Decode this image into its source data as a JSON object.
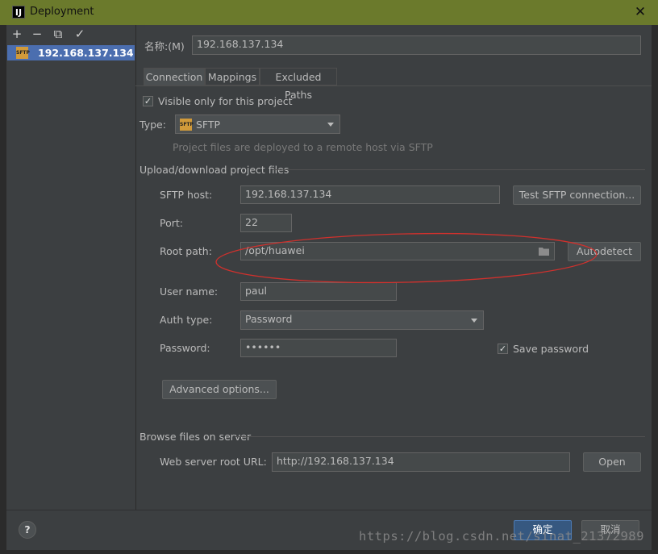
{
  "window": {
    "title": "Deployment",
    "app_icon": "IJ"
  },
  "toolbar": {
    "add": "+",
    "remove": "−",
    "copy": "⧉",
    "check": "✓"
  },
  "servers": [
    {
      "label": "192.168.137.134",
      "icon_text": "SFTP"
    }
  ],
  "name_field": {
    "label": "名称:(M)",
    "value": "192.168.137.134"
  },
  "tabs": [
    {
      "label": "Connection"
    },
    {
      "label": "Mappings"
    },
    {
      "label": "Excluded Paths"
    }
  ],
  "connection": {
    "visible_only_label": "Visible only for this project",
    "type_label": "Type:",
    "type_value": "SFTP",
    "type_icon_text": "SFTP",
    "type_hint": "Project files are deployed to a remote host via SFTP",
    "upload_section": "Upload/download project files",
    "sftp_host_label": "SFTP host:",
    "sftp_host_value": "192.168.137.134",
    "test_button": "Test SFTP connection...",
    "port_label": "Port:",
    "port_value": "22",
    "root_path_label": "Root path:",
    "root_path_value": "/opt/huawei",
    "autodetect_button": "Autodetect",
    "username_label": "User name:",
    "username_value": "paul",
    "auth_type_label": "Auth type:",
    "auth_type_value": "Password",
    "password_label": "Password:",
    "password_value": "••••••",
    "save_password_label": "Save password",
    "advanced_button": "Advanced options...",
    "browse_section": "Browse files on server",
    "web_root_label": "Web server root URL:",
    "web_root_value": "http://192.168.137.134",
    "open_button": "Open"
  },
  "footer": {
    "help": "?",
    "ok": "确定",
    "cancel": "取消"
  },
  "watermark": "https://blog.csdn.net/sinat_21372989",
  "colors": {
    "title_bar": "#6b7a2c",
    "selection": "#4b6eaf",
    "annotation": "#d0312d",
    "primary_button": "#365880"
  }
}
